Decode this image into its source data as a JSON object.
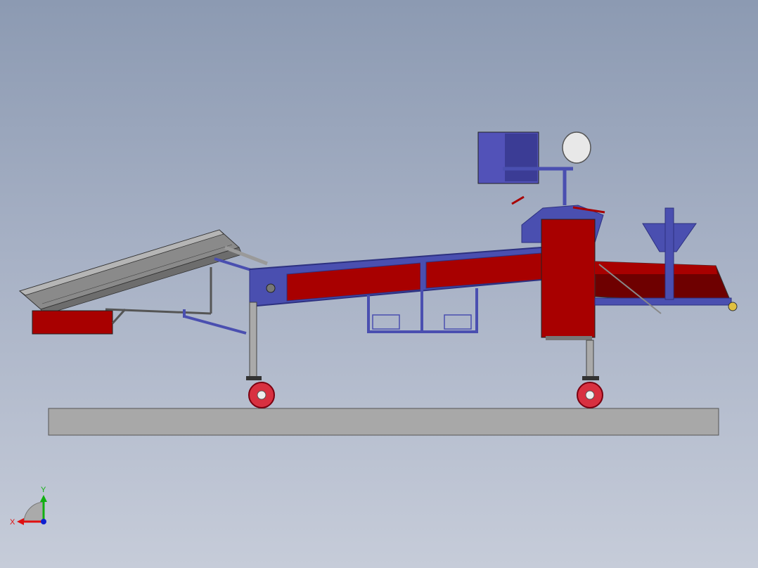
{
  "viewport": {
    "background_top": "#8c9ab2",
    "background_bottom": "#c6ccd9"
  },
  "colors": {
    "frame": "#4a4fb0",
    "frame_dark": "#2d3180",
    "panel_red": "#a80000",
    "panel_red_dark": "#6e0000",
    "steel": "#8e8e8e",
    "steel_light": "#b8b8b8",
    "ground": "#a8a8a8",
    "motor_box": "#5252b8",
    "motor_box_dark": "#3b3c95",
    "wheel": "#d83040"
  },
  "triad": {
    "x_label": "X",
    "y_label": "Y",
    "x_color": "#e01010",
    "y_color": "#10b010",
    "z_color": "#1020d0"
  }
}
